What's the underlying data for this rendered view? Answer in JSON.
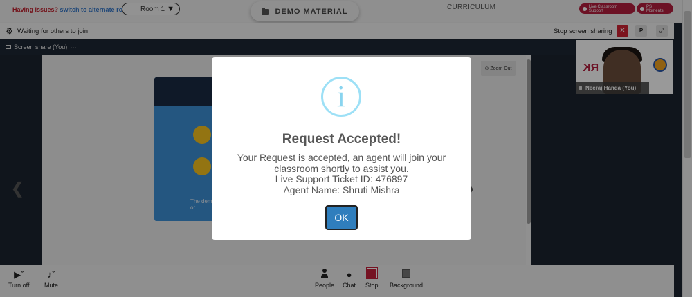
{
  "header": {
    "issue_prefix": "Having issues?",
    "issue_link": "switch to alternate room",
    "room_select": "Room 1",
    "demo_material": "DEMO MATERIAL",
    "curriculum": "CURRICULUM",
    "live_support": "Live Classroom Support",
    "ps_moments": "PS Moments"
  },
  "meeting": {
    "status": "Waiting for others to join",
    "stop_sharing": "Stop screen sharing",
    "p_button": "P",
    "share_tab": "Screen share (You)",
    "share_tab_more": "···",
    "zoom_out": "Zoom Out",
    "card_text_line1": "The dem",
    "card_text_line2": "or",
    "participant_name": "Neeraj Handa (You)",
    "logo_text": "RK"
  },
  "toolbar": {
    "turn_off": "Turn off",
    "mute": "Mute",
    "people": "People",
    "chat": "Chat",
    "stop": "Stop",
    "background": "Background"
  },
  "modal": {
    "icon_symbol": "i",
    "title": "Request Accepted!",
    "line1": "Your Request is accepted, an agent will join your classroom shortly to assist you.",
    "line2": "Live Support Ticket ID: 476897",
    "line3": "Agent Name: Shruti Mishra",
    "ok": "OK"
  },
  "colors": {
    "accent_red": "#c41e3a",
    "ok_blue": "#2f7ebd",
    "info_cyan": "#9de0f6",
    "meeting_dark": "#1c2330"
  }
}
